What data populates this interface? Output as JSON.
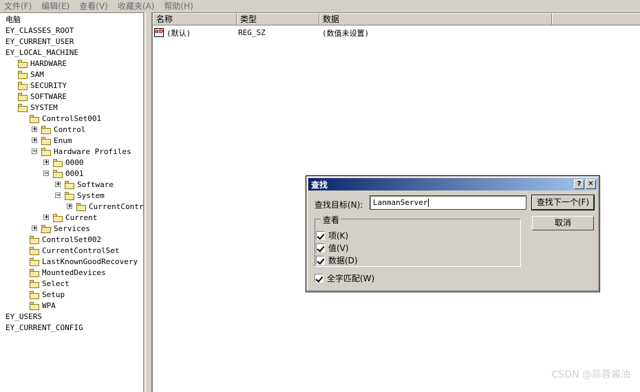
{
  "menubar": {
    "items": [
      {
        "label": "文件(F)",
        "name": "menu-file"
      },
      {
        "label": "编辑(E)",
        "name": "menu-edit"
      },
      {
        "label": "查看(V)",
        "name": "menu-view"
      },
      {
        "label": "收藏夹(A)",
        "name": "menu-favorites"
      },
      {
        "label": "帮助(H)",
        "name": "menu-help"
      }
    ]
  },
  "tree": {
    "nodes": [
      {
        "label": "电脑",
        "depth": 0,
        "toggle": "none",
        "icon": "none",
        "clipped": true
      },
      {
        "label": "EY_CLASSES_ROOT",
        "depth": 0,
        "toggle": "none",
        "icon": "none",
        "clipped": true
      },
      {
        "label": "EY_CURRENT_USER",
        "depth": 0,
        "toggle": "none",
        "icon": "none",
        "clipped": true
      },
      {
        "label": "EY_LOCAL_MACHINE",
        "depth": 0,
        "toggle": "none",
        "icon": "none",
        "clipped": true
      },
      {
        "label": "HARDWARE",
        "depth": 1,
        "toggle": "none",
        "icon": "folder"
      },
      {
        "label": "SAM",
        "depth": 1,
        "toggle": "none",
        "icon": "folder"
      },
      {
        "label": "SECURITY",
        "depth": 1,
        "toggle": "none",
        "icon": "folder"
      },
      {
        "label": "SOFTWARE",
        "depth": 1,
        "toggle": "none",
        "icon": "folder"
      },
      {
        "label": "SYSTEM",
        "depth": 1,
        "toggle": "none",
        "icon": "folder"
      },
      {
        "label": "ControlSet001",
        "depth": 2,
        "toggle": "none",
        "icon": "folder"
      },
      {
        "label": "Control",
        "depth": 3,
        "toggle": "plus",
        "icon": "folder"
      },
      {
        "label": "Enum",
        "depth": 3,
        "toggle": "plus",
        "icon": "folder"
      },
      {
        "label": "Hardware Profiles",
        "depth": 3,
        "toggle": "minus",
        "icon": "folder"
      },
      {
        "label": "0000",
        "depth": 4,
        "toggle": "plus",
        "icon": "folder"
      },
      {
        "label": "0001",
        "depth": 4,
        "toggle": "minus",
        "icon": "folder"
      },
      {
        "label": "Software",
        "depth": 5,
        "toggle": "plus",
        "icon": "folder"
      },
      {
        "label": "System",
        "depth": 5,
        "toggle": "minus",
        "icon": "folder"
      },
      {
        "label": "CurrentControlSet",
        "depth": 6,
        "toggle": "plus",
        "icon": "folder"
      },
      {
        "label": "Current",
        "depth": 4,
        "toggle": "plus",
        "icon": "folder"
      },
      {
        "label": "Services",
        "depth": 3,
        "toggle": "plus",
        "icon": "folder-open"
      },
      {
        "label": "ControlSet002",
        "depth": 2,
        "toggle": "none",
        "icon": "folder"
      },
      {
        "label": "CurrentControlSet",
        "depth": 2,
        "toggle": "none",
        "icon": "folder"
      },
      {
        "label": "LastKnownGoodRecovery",
        "depth": 2,
        "toggle": "none",
        "icon": "folder"
      },
      {
        "label": "MountedDevices",
        "depth": 2,
        "toggle": "none",
        "icon": "folder"
      },
      {
        "label": "Select",
        "depth": 2,
        "toggle": "none",
        "icon": "folder"
      },
      {
        "label": "Setup",
        "depth": 2,
        "toggle": "none",
        "icon": "folder"
      },
      {
        "label": "WPA",
        "depth": 2,
        "toggle": "none",
        "icon": "folder"
      },
      {
        "label": "EY_USERS",
        "depth": 0,
        "toggle": "none",
        "icon": "none",
        "clipped": true
      },
      {
        "label": "EY_CURRENT_CONFIG",
        "depth": 0,
        "toggle": "none",
        "icon": "none",
        "clipped": true
      }
    ]
  },
  "list": {
    "columns": [
      "名称",
      "类型",
      "数据",
      ""
    ],
    "rows": [
      {
        "name": "(默认)",
        "type": "REG_SZ",
        "data": "(数值未设置)",
        "icon": "string-value-icon"
      }
    ]
  },
  "dialog": {
    "title": "查找",
    "help_button": "?",
    "close_button": "✕",
    "find_label": "查找目标(N):",
    "find_value": "LanmanServer",
    "find_next_button": "查找下一个(F)",
    "cancel_button": "取消",
    "group_label": "查看",
    "checkboxes": [
      {
        "label": "项(K)",
        "checked": true,
        "name": "checkbox-keys"
      },
      {
        "label": "值(V)",
        "checked": true,
        "name": "checkbox-values"
      },
      {
        "label": "数据(D)",
        "checked": true,
        "name": "checkbox-data"
      }
    ],
    "whole_word": {
      "label": "全字匹配(W)",
      "checked": true
    }
  },
  "annotation": {
    "shape": "red-ellipse",
    "color": "#e8242a"
  },
  "watermark": {
    "text": "CSDN @蒜蓉酱油"
  }
}
